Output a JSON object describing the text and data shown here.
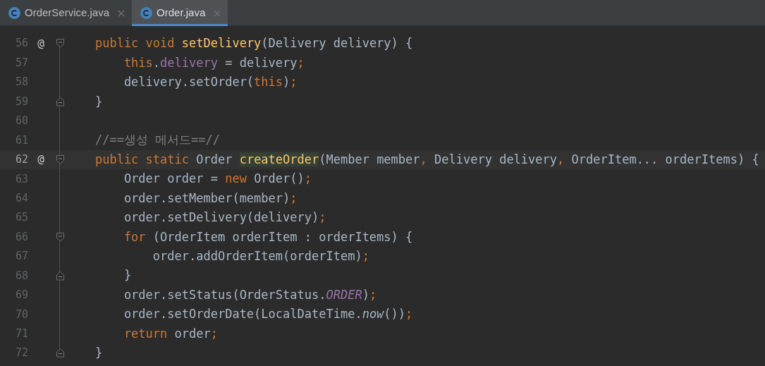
{
  "tabs": [
    {
      "label": "OrderService.java",
      "selected": false
    },
    {
      "label": "Order.java",
      "selected": true
    }
  ],
  "editor": {
    "lines": [
      {
        "number": "56",
        "current": false,
        "marker": "@",
        "fold_open": true,
        "fold_close": false,
        "tokens": [
          {
            "kind": "keyword",
            "text": "    public void "
          },
          {
            "kind": "declaration",
            "text": "setDelivery"
          },
          {
            "kind": "plain",
            "text": "(Delivery delivery) {"
          }
        ]
      },
      {
        "number": "57",
        "current": false,
        "fold_open": false,
        "fold_close": false,
        "tokens": [
          {
            "kind": "keyword",
            "text": "        this"
          },
          {
            "kind": "plain",
            "text": "."
          },
          {
            "kind": "field",
            "text": "delivery"
          },
          {
            "kind": "plain",
            "text": " = delivery"
          },
          {
            "kind": "keyword",
            "text": ";"
          }
        ]
      },
      {
        "number": "58",
        "current": false,
        "fold_open": false,
        "fold_close": false,
        "tokens": [
          {
            "kind": "plain",
            "text": "        delivery.setOrder("
          },
          {
            "kind": "keyword",
            "text": "this"
          },
          {
            "kind": "plain",
            "text": ")"
          },
          {
            "kind": "keyword",
            "text": ";"
          }
        ]
      },
      {
        "number": "59",
        "current": false,
        "fold_open": false,
        "fold_close": true,
        "tokens": [
          {
            "kind": "plain",
            "text": "    }"
          }
        ]
      },
      {
        "number": "60",
        "current": false,
        "fold_open": false,
        "fold_close": false
      },
      {
        "number": "61",
        "current": false,
        "fold_open": false,
        "fold_close": false,
        "tokens": [
          {
            "kind": "comment",
            "text": "    //==생성 메서드==//"
          }
        ]
      },
      {
        "number": "62",
        "current": true,
        "marker": "@",
        "fold_open": true,
        "fold_close": false,
        "tokens": [
          {
            "kind": "keyword",
            "text": "    public static "
          },
          {
            "kind": "plain",
            "text": "Order "
          },
          {
            "kind": "highlighted_declaration",
            "text": "createOrder"
          },
          {
            "kind": "plain",
            "text": "(Member member"
          },
          {
            "kind": "keyword",
            "text": ","
          },
          {
            "kind": "plain",
            "text": " Delivery delivery"
          },
          {
            "kind": "keyword",
            "text": ","
          },
          {
            "kind": "plain",
            "text": " OrderItem... orderItems) {"
          }
        ]
      },
      {
        "number": "63",
        "current": false,
        "fold_open": false,
        "fold_close": false,
        "tokens": [
          {
            "kind": "plain",
            "text": "        Order order = "
          },
          {
            "kind": "keyword",
            "text": "new "
          },
          {
            "kind": "plain",
            "text": "Order()"
          },
          {
            "kind": "keyword",
            "text": ";"
          }
        ]
      },
      {
        "number": "64",
        "current": false,
        "fold_open": false,
        "fold_close": false,
        "tokens": [
          {
            "kind": "plain",
            "text": "        order.setMember(member)"
          },
          {
            "kind": "keyword",
            "text": ";"
          }
        ]
      },
      {
        "number": "65",
        "current": false,
        "fold_open": false,
        "fold_close": false,
        "tokens": [
          {
            "kind": "plain",
            "text": "        order.setDelivery(delivery)"
          },
          {
            "kind": "keyword",
            "text": ";"
          }
        ]
      },
      {
        "number": "66",
        "current": false,
        "fold_open": true,
        "fold_close": false,
        "tokens": [
          {
            "kind": "keyword",
            "text": "        for "
          },
          {
            "kind": "plain",
            "text": "(OrderItem orderItem : orderItems) {"
          }
        ]
      },
      {
        "number": "67",
        "current": false,
        "fold_open": false,
        "fold_close": false,
        "tokens": [
          {
            "kind": "plain",
            "text": "            order.addOrderItem(orderItem)"
          },
          {
            "kind": "keyword",
            "text": ";"
          }
        ]
      },
      {
        "number": "68",
        "current": false,
        "fold_open": false,
        "fold_close": true,
        "tokens": [
          {
            "kind": "plain",
            "text": "        }"
          }
        ]
      },
      {
        "number": "69",
        "current": false,
        "fold_open": false,
        "fold_close": false,
        "tokens": [
          {
            "kind": "plain",
            "text": "        order.setStatus(OrderStatus."
          },
          {
            "kind": "static_field",
            "text": "ORDER"
          },
          {
            "kind": "plain",
            "text": ")"
          },
          {
            "kind": "keyword",
            "text": ";"
          }
        ]
      },
      {
        "number": "70",
        "current": false,
        "fold_open": false,
        "fold_close": false,
        "tokens": [
          {
            "kind": "plain",
            "text": "        order.setOrderDate(LocalDateTime."
          },
          {
            "kind": "static_call",
            "text": "now"
          },
          {
            "kind": "plain",
            "text": "())"
          },
          {
            "kind": "keyword",
            "text": ";"
          }
        ]
      },
      {
        "number": "71",
        "current": false,
        "fold_open": false,
        "fold_close": false,
        "tokens": [
          {
            "kind": "keyword",
            "text": "        return "
          },
          {
            "kind": "plain",
            "text": "order"
          },
          {
            "kind": "keyword",
            "text": ";"
          }
        ]
      },
      {
        "number": "72",
        "current": false,
        "fold_open": false,
        "fold_close": true,
        "tokens": [
          {
            "kind": "plain",
            "text": "    }"
          }
        ]
      }
    ]
  }
}
